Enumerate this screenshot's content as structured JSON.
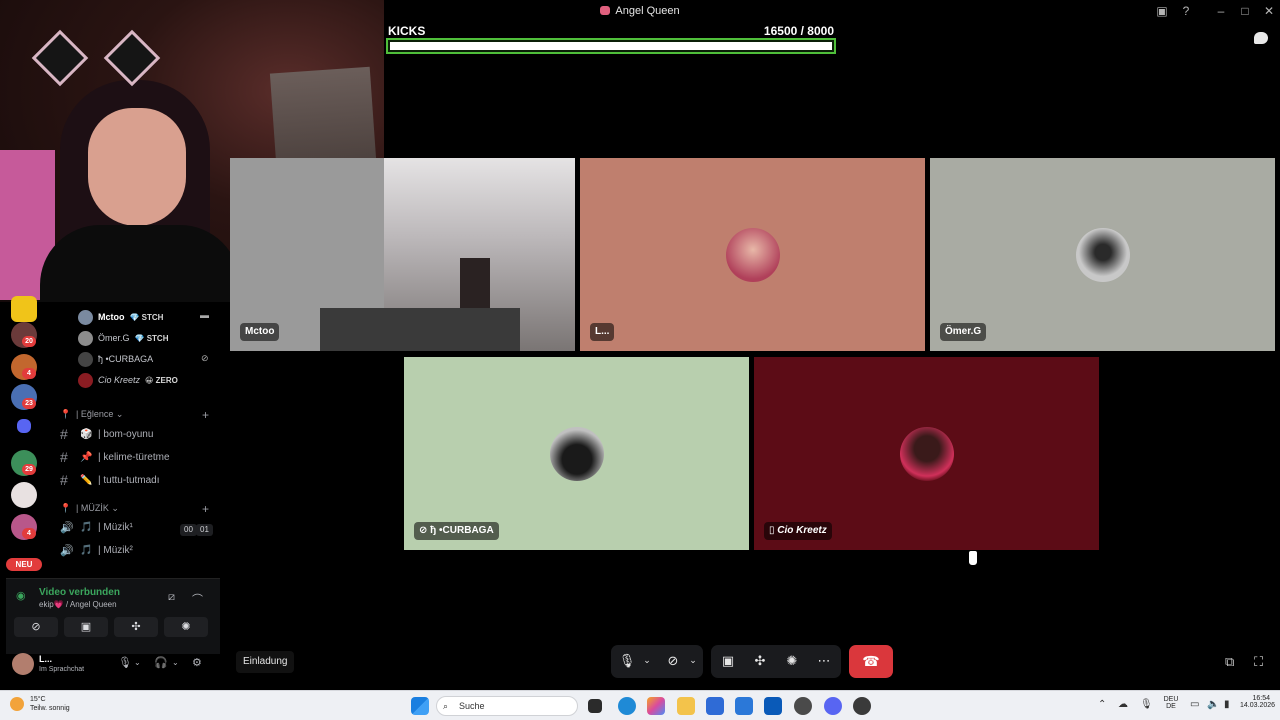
{
  "window": {
    "title": "Angel Queen"
  },
  "kicks": {
    "label": "KICKS",
    "count": "16500  / 8000",
    "progress": 1.0,
    "bar_color": "#4fbf3a"
  },
  "sidebar": {
    "server_badges": [
      "20",
      "4",
      "23",
      "29",
      "4"
    ],
    "neu_label": "NEU",
    "voice_users": [
      {
        "name": "Mctoo",
        "tag": "💎 STCH"
      },
      {
        "name": "Ömer.G",
        "tag": "💎 STCH"
      },
      {
        "name": "ђ •CURBAGA",
        "tag": ""
      },
      {
        "name": "Cio Kreetz",
        "tag": "😀 ZERO"
      }
    ],
    "categories": [
      {
        "label": "| Eğlence ⌄"
      },
      {
        "label": "| MÜZİK ⌄"
      }
    ],
    "text_channels": [
      {
        "emoji": "🎲",
        "label": "| bom-oyunu"
      },
      {
        "emoji": "📌",
        "label": "| kelime-türetme"
      },
      {
        "emoji": "✏️",
        "label": "| tuttu-tutmadı"
      }
    ],
    "voice_channels": [
      {
        "emoji": "🎵",
        "label": "| Müzik¹",
        "pills": [
          "00",
          "01"
        ]
      },
      {
        "emoji": "🎵",
        "label": "| Müzik²",
        "pills": []
      }
    ],
    "voice_panel": {
      "status": "Video verbunden",
      "sub": "ekip💗 / Angel Queen"
    },
    "user_panel": {
      "name": "L...",
      "status": "Im Sprachchat"
    }
  },
  "tiles": [
    {
      "label": "Mctoo",
      "bg": "#9a9a9a",
      "kind": "video"
    },
    {
      "label": "L...",
      "bg": "#bf7f6e",
      "kind": "avatar"
    },
    {
      "label": "Ömer.G",
      "bg": "#a9aba3",
      "kind": "avatar"
    },
    {
      "label": "ђ •CURBAGA",
      "bg": "#b8cfae",
      "kind": "avatar"
    },
    {
      "label": "Cio Kreetz",
      "bg": "#5c0c16",
      "kind": "avatar"
    }
  ],
  "controls": {
    "invite_label": "Einladung"
  },
  "taskbar": {
    "weather_temp": "15°C",
    "weather_desc": "Teilw. sonnig",
    "search_placeholder": "Suche",
    "lang_top": "DEU",
    "lang_bottom": "DE",
    "time": "16:54",
    "date": "14.03.2026"
  }
}
